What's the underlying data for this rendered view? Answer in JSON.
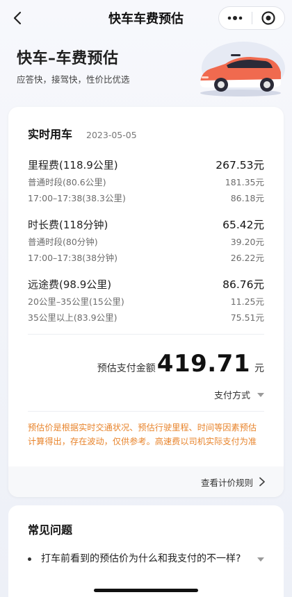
{
  "header": {
    "title": "快车车费预估",
    "back_icon": "chevron-left-icon",
    "more_icon": "more-dots-icon",
    "target_icon": "target-circle-icon"
  },
  "hero": {
    "title": "快车–车费预估",
    "subtitle": "应答快，接驾快，性价比优选",
    "car_color": "#f06a4f"
  },
  "estimate": {
    "heading": "实时用车",
    "date": "2023-05-05",
    "groups": [
      {
        "label": "里程费(118.9公里)",
        "amount": "267.53元",
        "items": [
          {
            "label": "普通时段(80.6公里)",
            "amount": "181.35元"
          },
          {
            "label": "17:00–17:38(38.3公里)",
            "amount": "86.18元"
          }
        ]
      },
      {
        "label": "时长费(118分钟)",
        "amount": "65.42元",
        "items": [
          {
            "label": "普通时段(80分钟)",
            "amount": "39.20元"
          },
          {
            "label": "17:00–17:38(38分钟)",
            "amount": "26.22元"
          }
        ]
      },
      {
        "label": "远途费(98.9公里)",
        "amount": "86.76元",
        "items": [
          {
            "label": "20公里–35公里(15公里)",
            "amount": "11.25元"
          },
          {
            "label": "35公里以上(83.9公里)",
            "amount": "75.51元"
          }
        ]
      }
    ],
    "total_label": "预估支付金额",
    "total_value": "419.71",
    "total_unit": "元",
    "pay_method": "支付方式",
    "notice": "预估价是根据实时交通状况、预估行驶里程、时间等因素预估计算得出，存在波动，仅供参考。高速费以司机实际支付为准",
    "rules_link": "查看计价规则",
    "notice_color": "#e8842c"
  },
  "faq": {
    "title": "常见问题",
    "items": [
      {
        "question": "打车前看到的预估价为什么和我支付的不一样?"
      }
    ]
  }
}
